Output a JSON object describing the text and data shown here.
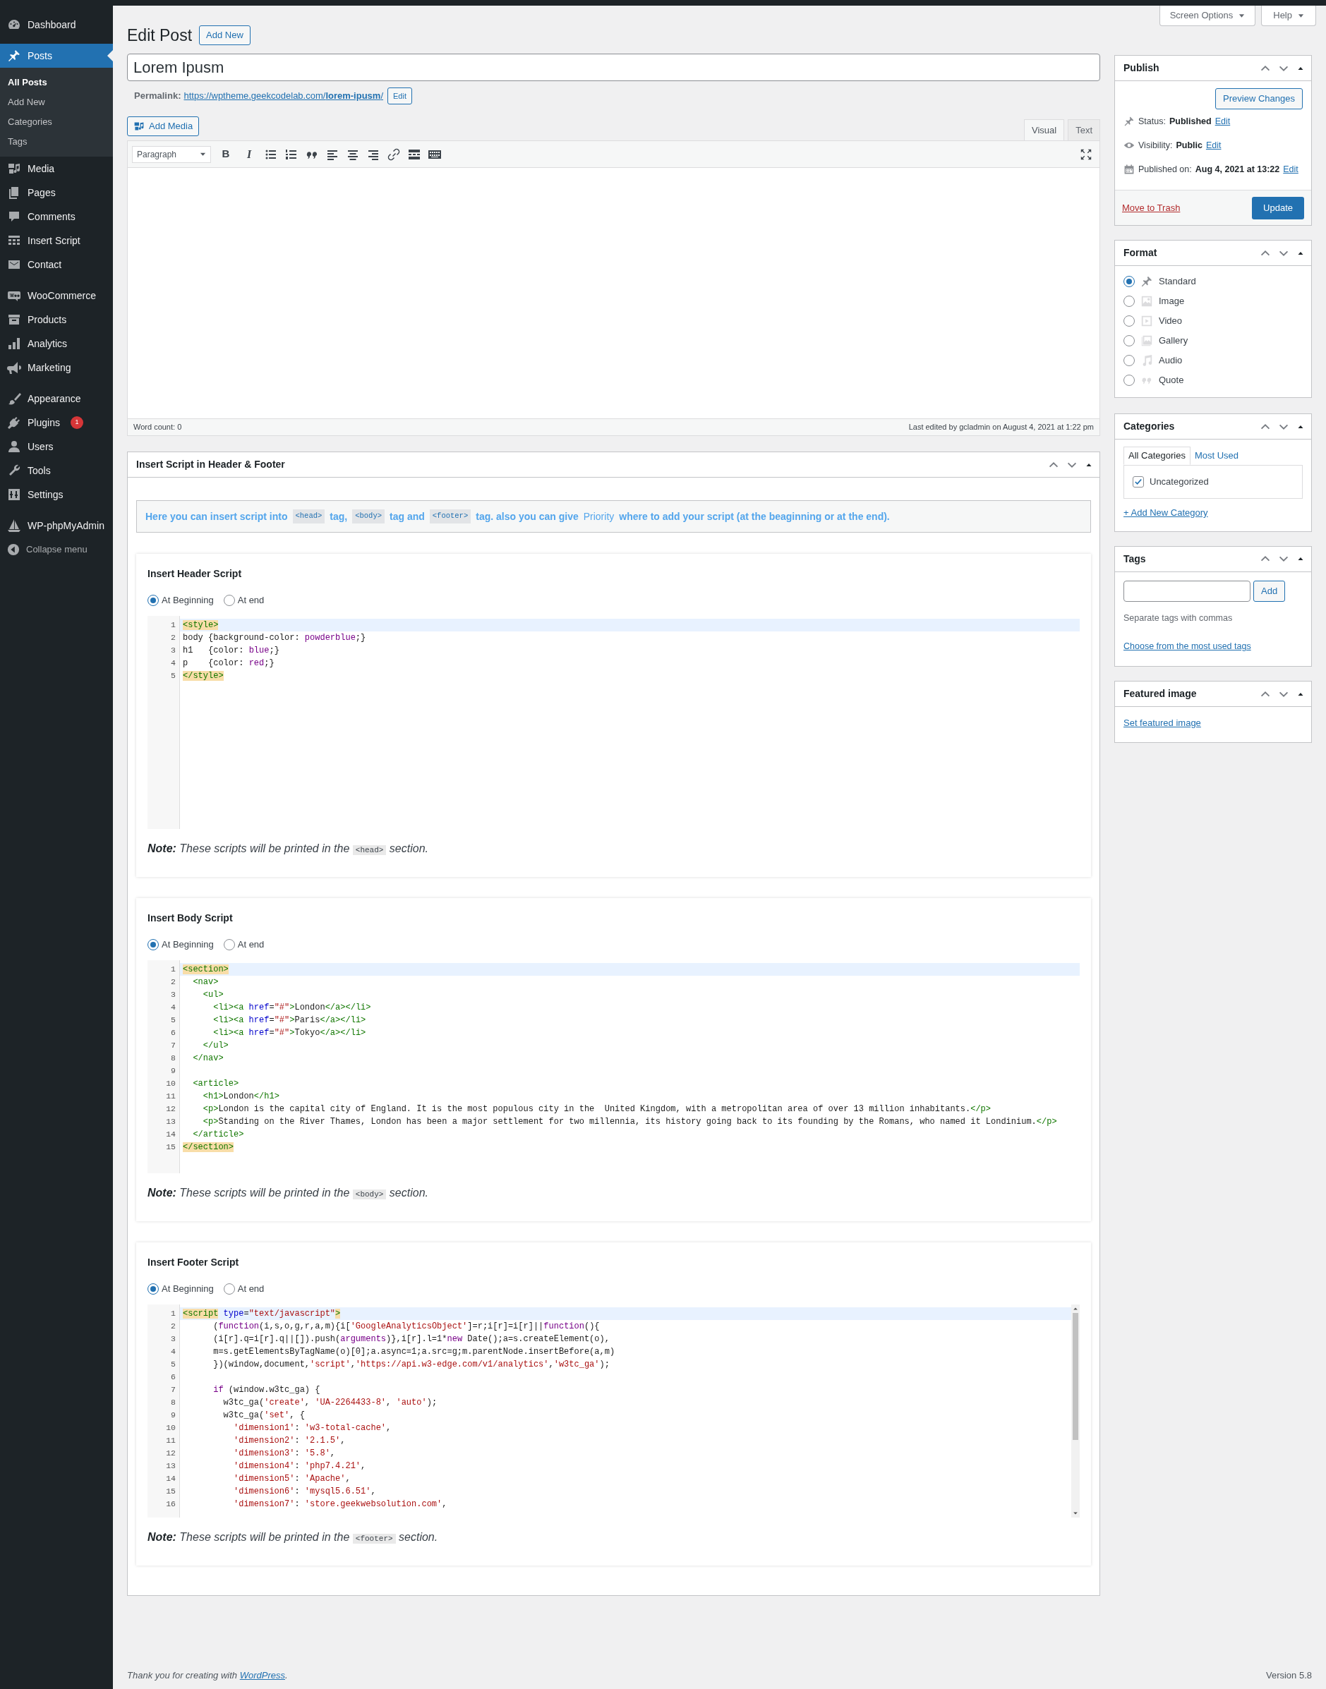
{
  "sidebar": {
    "groups": [
      {
        "items": [
          {
            "label": "Dashboard",
            "selected": false
          }
        ]
      },
      {
        "items": [
          {
            "label": "Posts",
            "selected": true,
            "children": [
              {
                "label": "All Posts",
                "selected": true
              },
              {
                "label": "Add New",
                "selected": false
              },
              {
                "label": "Categories",
                "selected": false
              },
              {
                "label": "Tags",
                "selected": false
              }
            ]
          },
          {
            "label": "Media",
            "selected": false
          },
          {
            "label": "Pages",
            "selected": false
          },
          {
            "label": "Comments",
            "selected": false
          },
          {
            "label": "Insert Script",
            "selected": false
          },
          {
            "label": "Contact",
            "selected": false
          }
        ]
      },
      {
        "items": [
          {
            "label": "WooCommerce",
            "selected": false
          },
          {
            "label": "Products",
            "selected": false
          },
          {
            "label": "Analytics",
            "selected": false
          },
          {
            "label": "Marketing",
            "selected": false
          }
        ]
      },
      {
        "items": [
          {
            "label": "Appearance",
            "selected": false
          },
          {
            "label": "Plugins",
            "selected": false,
            "badge": "1"
          },
          {
            "label": "Users",
            "selected": false
          },
          {
            "label": "Tools",
            "selected": false
          },
          {
            "label": "Settings",
            "selected": false
          }
        ]
      },
      {
        "items": [
          {
            "label": "WP-phpMyAdmin",
            "selected": false
          }
        ]
      }
    ],
    "collapse_menu": "Collapse menu"
  },
  "screen_options": "Screen Options",
  "help": "Help",
  "heading": "Edit Post",
  "add_new": "Add New",
  "title": "Lorem Ipusm",
  "permalink": {
    "label": "Permalink:",
    "url": "https://wptheme.geekcodelab.com/**lorem-ipusm**/",
    "edit": "Edit"
  },
  "add_media": "Add Media",
  "editor_tabs": [
    {
      "label": "Visual",
      "selected": true
    },
    {
      "label": "Text",
      "selected": false
    }
  ],
  "format_select": "Paragraph",
  "toolbar": {
    "bold": "B",
    "italic": "I"
  },
  "word_count": "Word count: 0",
  "last_edited": "Last edited by gcladmin on August 4, 2021 at 1:22 pm",
  "script_box": {
    "title": "Insert Script in Header & Footer",
    "info": [
      {
        "kind": "text",
        "text": "Here you can insert script into"
      },
      {
        "kind": "code",
        "text": "<head>"
      },
      {
        "kind": "text",
        "text": "tag,"
      },
      {
        "kind": "code",
        "text": "<body>"
      },
      {
        "kind": "text",
        "text": "tag and"
      },
      {
        "kind": "code",
        "text": "<footer>"
      },
      {
        "kind": "text",
        "text": "tag. also you can give"
      },
      {
        "kind": "plain",
        "text": "Priority"
      },
      {
        "kind": "text",
        "text": "where to add your script (at the beaginning or at the end)."
      }
    ],
    "sections": [
      {
        "title": "Insert Header Script",
        "scrollable": false,
        "positions": [
          {
            "label": "At Beginning",
            "selected": true
          },
          {
            "label": "At end",
            "selected": false
          }
        ],
        "lines": [
          {
            "number": "1",
            "active": true,
            "tokens": [
              {
                "kind": "match",
                "text": "<style>"
              }
            ]
          },
          {
            "number": "2",
            "active": false,
            "tokens": [
              {
                "kind": "plain",
                "text": "body {background-color: "
              },
              {
                "kind": "keyword",
                "text": "powderblue"
              },
              {
                "kind": "plain",
                "text": ";}"
              }
            ]
          },
          {
            "number": "3",
            "active": false,
            "tokens": [
              {
                "kind": "plain",
                "text": "h1   {color: "
              },
              {
                "kind": "keyword",
                "text": "blue"
              },
              {
                "kind": "plain",
                "text": ";}"
              }
            ]
          },
          {
            "number": "4",
            "active": false,
            "tokens": [
              {
                "kind": "plain",
                "text": "p    {color: "
              },
              {
                "kind": "keyword",
                "text": "red"
              },
              {
                "kind": "plain",
                "text": ";}"
              }
            ]
          },
          {
            "number": "5",
            "active": false,
            "tokens": [
              {
                "kind": "match",
                "text": "</style>"
              }
            ]
          }
        ],
        "note": {
          "label": "Note:",
          "text": "These scripts will be printed in the",
          "code": "<head>",
          "after": "section."
        }
      },
      {
        "title": "Insert Body Script",
        "scrollable": false,
        "positions": [
          {
            "label": "At Beginning",
            "selected": true
          },
          {
            "label": "At end",
            "selected": false
          }
        ],
        "lines": [
          {
            "number": "1",
            "active": true,
            "tokens": [
              {
                "kind": "match",
                "text": "<section>"
              }
            ]
          },
          {
            "number": "2",
            "active": false,
            "tokens": [
              {
                "kind": "tag",
                "text": "  <nav>"
              }
            ]
          },
          {
            "number": "3",
            "active": false,
            "tokens": [
              {
                "kind": "tag",
                "text": "    <ul>"
              }
            ]
          },
          {
            "number": "4",
            "active": false,
            "tokens": [
              {
                "kind": "tag",
                "text": "      <li><a"
              },
              {
                "kind": "attr",
                "text": " href"
              },
              {
                "kind": "plain",
                "text": "="
              },
              {
                "kind": "string",
                "text": "\"#\""
              },
              {
                "kind": "tag",
                "text": ">"
              },
              {
                "kind": "plain",
                "text": "London"
              },
              {
                "kind": "tag",
                "text": "</a></li>"
              }
            ]
          },
          {
            "number": "5",
            "active": false,
            "tokens": [
              {
                "kind": "tag",
                "text": "      <li><a"
              },
              {
                "kind": "attr",
                "text": " href"
              },
              {
                "kind": "plain",
                "text": "="
              },
              {
                "kind": "string",
                "text": "\"#\""
              },
              {
                "kind": "tag",
                "text": ">"
              },
              {
                "kind": "plain",
                "text": "Paris"
              },
              {
                "kind": "tag",
                "text": "</a></li>"
              }
            ]
          },
          {
            "number": "6",
            "active": false,
            "tokens": [
              {
                "kind": "tag",
                "text": "      <li><a"
              },
              {
                "kind": "attr",
                "text": " href"
              },
              {
                "kind": "plain",
                "text": "="
              },
              {
                "kind": "string",
                "text": "\"#\""
              },
              {
                "kind": "tag",
                "text": ">"
              },
              {
                "kind": "plain",
                "text": "Tokyo"
              },
              {
                "kind": "tag",
                "text": "</a></li>"
              }
            ]
          },
          {
            "number": "7",
            "active": false,
            "tokens": [
              {
                "kind": "tag",
                "text": "    </ul>"
              }
            ]
          },
          {
            "number": "8",
            "active": false,
            "tokens": [
              {
                "kind": "tag",
                "text": "  </nav>"
              }
            ]
          },
          {
            "number": "9",
            "active": false
          },
          {
            "number": "10",
            "active": false,
            "tokens": [
              {
                "kind": "tag",
                "text": "  <article>"
              }
            ]
          },
          {
            "number": "11",
            "active": false,
            "tokens": [
              {
                "kind": "tag",
                "text": "    <h1>"
              },
              {
                "kind": "plain",
                "text": "London"
              },
              {
                "kind": "tag",
                "text": "</h1>"
              }
            ]
          },
          {
            "number": "12",
            "active": false,
            "tokens": [
              {
                "kind": "tag",
                "text": "    <p>"
              },
              {
                "kind": "plain",
                "text": "London is the capital city of England. It is the most populous city in the  United Kingdom, with a metropolitan area of over 13 million inhabitants."
              },
              {
                "kind": "tag",
                "text": "</p>"
              }
            ]
          },
          {
            "number": "13",
            "active": false,
            "tokens": [
              {
                "kind": "tag",
                "text": "    <p>"
              },
              {
                "kind": "plain",
                "text": "Standing on the River Thames, London has been a major settlement for two millennia, its history going back to its founding by the Romans, who named it Londinium."
              },
              {
                "kind": "tag",
                "text": "</p>"
              }
            ]
          },
          {
            "number": "14",
            "active": false,
            "tokens": [
              {
                "kind": "tag",
                "text": "  </article>"
              }
            ]
          },
          {
            "number": "15",
            "active": false,
            "tokens": [
              {
                "kind": "match",
                "text": "</section>"
              }
            ]
          }
        ],
        "note": {
          "label": "Note:",
          "text": "These scripts will be printed in the",
          "code": "<body>",
          "after": "section."
        }
      },
      {
        "title": "Insert Footer Script",
        "scrollable": true,
        "positions": [
          {
            "label": "At Beginning",
            "selected": true
          },
          {
            "label": "At end",
            "selected": false
          }
        ],
        "lines": [
          {
            "number": "1",
            "active": true,
            "tokens": [
              {
                "kind": "match",
                "text": "<script"
              },
              {
                "kind": "attr",
                "text": " type"
              },
              {
                "kind": "plain",
                "text": "="
              },
              {
                "kind": "string",
                "text": "\"text/javascript\""
              },
              {
                "kind": "match",
                "text": ">"
              }
            ]
          },
          {
            "number": "2",
            "active": false,
            "tokens": [
              {
                "kind": "plain",
                "text": "      ("
              },
              {
                "kind": "keyword",
                "text": "function"
              },
              {
                "kind": "plain",
                "text": "(i,s,o,g,r,a,m){i["
              },
              {
                "kind": "string",
                "text": "'GoogleAnalyticsObject'"
              },
              {
                "kind": "plain",
                "text": "]=r;i[r]=i[r]||"
              },
              {
                "kind": "keyword",
                "text": "function"
              },
              {
                "kind": "plain",
                "text": "(){"
              }
            ]
          },
          {
            "number": "3",
            "active": false,
            "tokens": [
              {
                "kind": "plain",
                "text": "      (i[r].q=i[r].q||[]).push("
              },
              {
                "kind": "keyword",
                "text": "arguments"
              },
              {
                "kind": "plain",
                "text": ")},i[r].l=1*"
              },
              {
                "kind": "keyword",
                "text": "new"
              },
              {
                "kind": "plain",
                "text": " Date();a=s.createElement(o),"
              }
            ]
          },
          {
            "number": "4",
            "active": false,
            "tokens": [
              {
                "kind": "plain",
                "text": "      m=s.getElementsByTagName(o)[0];a.async=1;a.src=g;m.parentNode.insertBefore(a,m)"
              }
            ]
          },
          {
            "number": "5",
            "active": false,
            "tokens": [
              {
                "kind": "plain",
                "text": "      })(window,document,"
              },
              {
                "kind": "string",
                "text": "'script'"
              },
              {
                "kind": "plain",
                "text": ","
              },
              {
                "kind": "string",
                "text": "'https://api.w3-edge.com/v1/analytics'"
              },
              {
                "kind": "plain",
                "text": ","
              },
              {
                "kind": "string",
                "text": "'w3tc_ga'"
              },
              {
                "kind": "plain",
                "text": ");"
              }
            ]
          },
          {
            "number": "6",
            "active": false
          },
          {
            "number": "7",
            "active": false,
            "tokens": [
              {
                "kind": "keyword",
                "text": "      if"
              },
              {
                "kind": "plain",
                "text": " (window.w3tc_ga) {"
              }
            ]
          },
          {
            "number": "8",
            "active": false,
            "tokens": [
              {
                "kind": "plain",
                "text": "        w3tc_ga("
              },
              {
                "kind": "string",
                "text": "'create'"
              },
              {
                "kind": "plain",
                "text": ", "
              },
              {
                "kind": "string",
                "text": "'UA-2264433-8'"
              },
              {
                "kind": "plain",
                "text": ", "
              },
              {
                "kind": "string",
                "text": "'auto'"
              },
              {
                "kind": "plain",
                "text": ");"
              }
            ]
          },
          {
            "number": "9",
            "active": false,
            "tokens": [
              {
                "kind": "plain",
                "text": "        w3tc_ga("
              },
              {
                "kind": "string",
                "text": "'set'"
              },
              {
                "kind": "plain",
                "text": ", {"
              }
            ]
          },
          {
            "number": "10",
            "active": false,
            "tokens": [
              {
                "kind": "string",
                "text": "          'dimension1'"
              },
              {
                "kind": "plain",
                "text": ": "
              },
              {
                "kind": "string",
                "text": "'w3-total-cache'"
              },
              {
                "kind": "plain",
                "text": ","
              }
            ]
          },
          {
            "number": "11",
            "active": false,
            "tokens": [
              {
                "kind": "string",
                "text": "          'dimension2'"
              },
              {
                "kind": "plain",
                "text": ": "
              },
              {
                "kind": "string",
                "text": "'2.1.5'"
              },
              {
                "kind": "plain",
                "text": ","
              }
            ]
          },
          {
            "number": "12",
            "active": false,
            "tokens": [
              {
                "kind": "string",
                "text": "          'dimension3'"
              },
              {
                "kind": "plain",
                "text": ": "
              },
              {
                "kind": "string",
                "text": "'5.8'"
              },
              {
                "kind": "plain",
                "text": ","
              }
            ]
          },
          {
            "number": "13",
            "active": false,
            "tokens": [
              {
                "kind": "string",
                "text": "          'dimension4'"
              },
              {
                "kind": "plain",
                "text": ": "
              },
              {
                "kind": "string",
                "text": "'php7.4.21'"
              },
              {
                "kind": "plain",
                "text": ","
              }
            ]
          },
          {
            "number": "14",
            "active": false,
            "tokens": [
              {
                "kind": "string",
                "text": "          'dimension5'"
              },
              {
                "kind": "plain",
                "text": ": "
              },
              {
                "kind": "string",
                "text": "'Apache'"
              },
              {
                "kind": "plain",
                "text": ","
              }
            ]
          },
          {
            "number": "15",
            "active": false,
            "tokens": [
              {
                "kind": "string",
                "text": "          'dimension6'"
              },
              {
                "kind": "plain",
                "text": ": "
              },
              {
                "kind": "string",
                "text": "'mysql5.6.51'"
              },
              {
                "kind": "plain",
                "text": ","
              }
            ]
          },
          {
            "number": "16",
            "active": false,
            "tokens": [
              {
                "kind": "string",
                "text": "          'dimension7'"
              },
              {
                "kind": "plain",
                "text": ": "
              },
              {
                "kind": "string",
                "text": "'store.geekwebsolution.com'"
              },
              {
                "kind": "plain",
                "text": ","
              }
            ]
          }
        ],
        "note": {
          "label": "Note:",
          "text": "These scripts will be printed in the",
          "code": "<footer>",
          "after": "section."
        }
      }
    ]
  },
  "publish": {
    "title": "Publish",
    "preview": "Preview Changes",
    "rows": [
      {
        "label": "Status:",
        "value": "Published",
        "edit": "Edit"
      },
      {
        "label": "Visibility:",
        "value": "Public",
        "edit": "Edit"
      },
      {
        "label": "Published on:",
        "value": "Aug 4, 2021 at 13:22",
        "edit": "Edit"
      }
    ],
    "trash": "Move to Trash",
    "update": "Update"
  },
  "format": {
    "title": "Format",
    "options": [
      {
        "label": "Standard",
        "selected": true
      },
      {
        "label": "Image",
        "selected": false
      },
      {
        "label": "Video",
        "selected": false
      },
      {
        "label": "Gallery",
        "selected": false
      },
      {
        "label": "Audio",
        "selected": false
      },
      {
        "label": "Quote",
        "selected": false
      }
    ]
  },
  "categories": {
    "title": "Categories",
    "tabs": [
      {
        "label": "All Categories",
        "selected": true
      },
      {
        "label": "Most Used",
        "selected": false
      }
    ],
    "items": [
      {
        "label": "Uncategorized",
        "checked": true
      }
    ],
    "add_new": "+ Add New Category"
  },
  "tags": {
    "title": "Tags",
    "add": "Add",
    "hint": "Separate tags with commas",
    "choose": "Choose from the most used tags"
  },
  "featured_image": {
    "title": "Featured image",
    "link": "Set featured image"
  },
  "footer": {
    "thanks": "Thank you for creating with",
    "link": "WordPress",
    "after": ".",
    "version": "Version 5.8"
  }
}
